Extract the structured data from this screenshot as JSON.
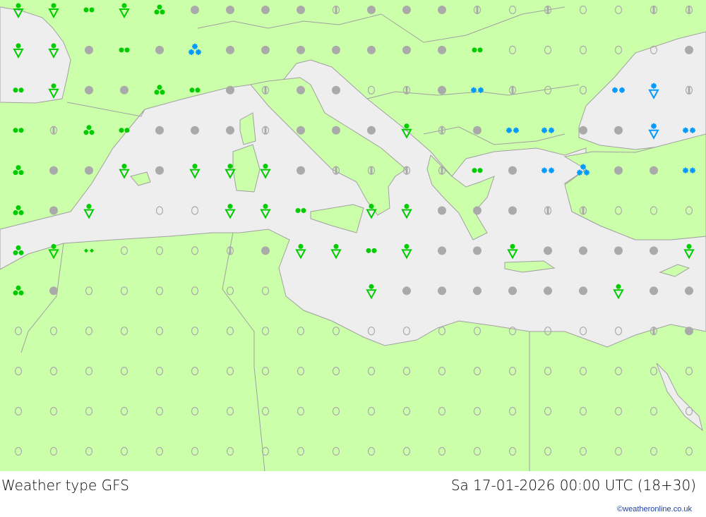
{
  "footer": {
    "title": "Weather type   GFS",
    "datetime": "Sa 17-01-2026 00:00 UTC (18+30)",
    "credit": "©weatheronline.co.uk"
  },
  "colors": {
    "land": "#ccffaa",
    "sea": "#eeeeee",
    "coast": "#a0a0a0",
    "cloud": "#aaaaaa",
    "rain": "#00cc00",
    "snow": "#0099ff"
  },
  "symbol_legend": {
    "O": "overcast",
    "C": "clear",
    "H": "partly-cloudy",
    "R": "rain-shower",
    "D2": "rain",
    "D3": "heavy-rain",
    "DZ": "drizzle",
    "S2": "snow",
    "S3": "heavy-snow",
    "SS": "snow-shower",
    "-": "none"
  },
  "weather_grid": [
    [
      "R",
      "R",
      "D2",
      "R",
      "D3",
      "O",
      "O",
      "O",
      "O",
      "H",
      "O",
      "O",
      "O",
      "H",
      "C",
      "H",
      "C",
      "C",
      "H",
      "H"
    ],
    [
      "R",
      "R",
      "O",
      "D2",
      "O",
      "S3",
      "O",
      "O",
      "O",
      "O",
      "O",
      "O",
      "O",
      "D2",
      "C",
      "C",
      "C",
      "C",
      "C",
      "O"
    ],
    [
      "D2",
      "R",
      "O",
      "O",
      "D3",
      "D2",
      "O",
      "H",
      "O",
      "O",
      "C",
      "H",
      "O",
      "S2",
      "H",
      "C",
      "C",
      "S2",
      "SS",
      "H"
    ],
    [
      "D2",
      "H",
      "D3",
      "D2",
      "O",
      "O",
      "O",
      "H",
      "O",
      "O",
      "O",
      "R",
      "H",
      "O",
      "S2",
      "S2",
      "O",
      "O",
      "SS",
      "S2"
    ],
    [
      "D3",
      "O",
      "O",
      "R",
      "O",
      "R",
      "R",
      "R",
      "O",
      "H",
      "H",
      "H",
      "H",
      "D2",
      "O",
      "S2",
      "S3",
      "O",
      "O",
      "S2"
    ],
    [
      "D3",
      "O",
      "R",
      "-",
      "C",
      "C",
      "R",
      "R",
      "D2",
      "-",
      "R",
      "R",
      "O",
      "O",
      "O",
      "H",
      "H",
      "C",
      "C",
      "C"
    ],
    [
      "D3",
      "R",
      "DZ",
      "C",
      "C",
      "C",
      "H",
      "O",
      "R",
      "R",
      "D2",
      "R",
      "O",
      "O",
      "R",
      "O",
      "O",
      "O",
      "O",
      "R"
    ],
    [
      "D3",
      "O",
      "C",
      "C",
      "C",
      "C",
      "C",
      "C",
      "-",
      "-",
      "R",
      "O",
      "O",
      "O",
      "O",
      "O",
      "O",
      "R",
      "O",
      "O"
    ],
    [
      "C",
      "C",
      "C",
      "C",
      "C",
      "C",
      "C",
      "C",
      "C",
      "C",
      "C",
      "C",
      "C",
      "C",
      "C",
      "C",
      "C",
      "C",
      "H",
      "O"
    ],
    [
      "C",
      "C",
      "C",
      "C",
      "C",
      "C",
      "C",
      "C",
      "C",
      "C",
      "C",
      "C",
      "C",
      "C",
      "C",
      "C",
      "C",
      "C",
      "C",
      "C"
    ],
    [
      "C",
      "C",
      "C",
      "C",
      "C",
      "C",
      "C",
      "C",
      "C",
      "C",
      "C",
      "C",
      "C",
      "C",
      "C",
      "C",
      "C",
      "C",
      "C",
      "C"
    ],
    [
      "C",
      "C",
      "C",
      "C",
      "C",
      "C",
      "C",
      "C",
      "C",
      "C",
      "C",
      "C",
      "C",
      "C",
      "C",
      "C",
      "C",
      "C",
      "C",
      "C"
    ]
  ]
}
